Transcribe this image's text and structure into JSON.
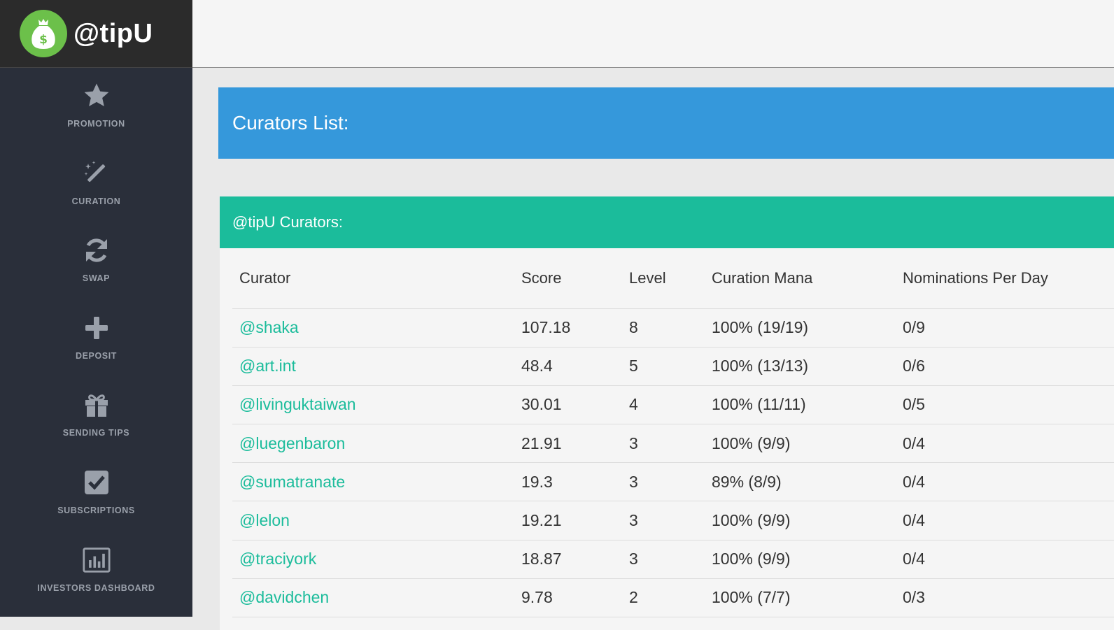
{
  "brand": {
    "name": "@tipU",
    "logo_icon": "money-bag-icon"
  },
  "sidebar": {
    "items": [
      {
        "label": "PROMOTION",
        "icon": "star-icon"
      },
      {
        "label": "CURATION",
        "icon": "magic-wand-icon"
      },
      {
        "label": "SWAP",
        "icon": "refresh-icon"
      },
      {
        "label": "DEPOSIT",
        "icon": "plus-icon"
      },
      {
        "label": "SENDING TIPS",
        "icon": "gift-icon"
      },
      {
        "label": "SUBSCRIPTIONS",
        "icon": "checkbox-icon"
      },
      {
        "label": "INVESTORS DASHBOARD",
        "icon": "bar-chart-icon"
      }
    ]
  },
  "main": {
    "title": "Curators List:",
    "panel_title": "@tipU Curators:",
    "table": {
      "headers": [
        "Curator",
        "Score",
        "Level",
        "Curation Mana",
        "Nominations Per Day"
      ],
      "rows": [
        [
          "@shaka",
          "107.18",
          "8",
          "100% (19/19)",
          "0/9"
        ],
        [
          "@art.int",
          "48.4",
          "5",
          "100% (13/13)",
          "0/6"
        ],
        [
          "@livinguktaiwan",
          "30.01",
          "4",
          "100% (11/11)",
          "0/5"
        ],
        [
          "@luegenbaron",
          "21.91",
          "3",
          "100% (9/9)",
          "0/4"
        ],
        [
          "@sumatranate",
          "19.3",
          "3",
          "89% (8/9)",
          "0/4"
        ],
        [
          "@lelon",
          "19.21",
          "3",
          "100% (9/9)",
          "0/4"
        ],
        [
          "@traciyork",
          "18.87",
          "3",
          "100% (9/9)",
          "0/4"
        ],
        [
          "@davidchen",
          "9.78",
          "2",
          "100% (7/7)",
          "0/3"
        ]
      ]
    }
  },
  "colors": {
    "sidebar_bg": "#2a2f3a",
    "brand_bg": "#2b2b2b",
    "logo_green": "#6cc04a",
    "title_blue": "#3598db",
    "panel_teal": "#1bbc9b",
    "link_teal": "#1bbc9b",
    "icon_gray": "#9aa0aa"
  }
}
